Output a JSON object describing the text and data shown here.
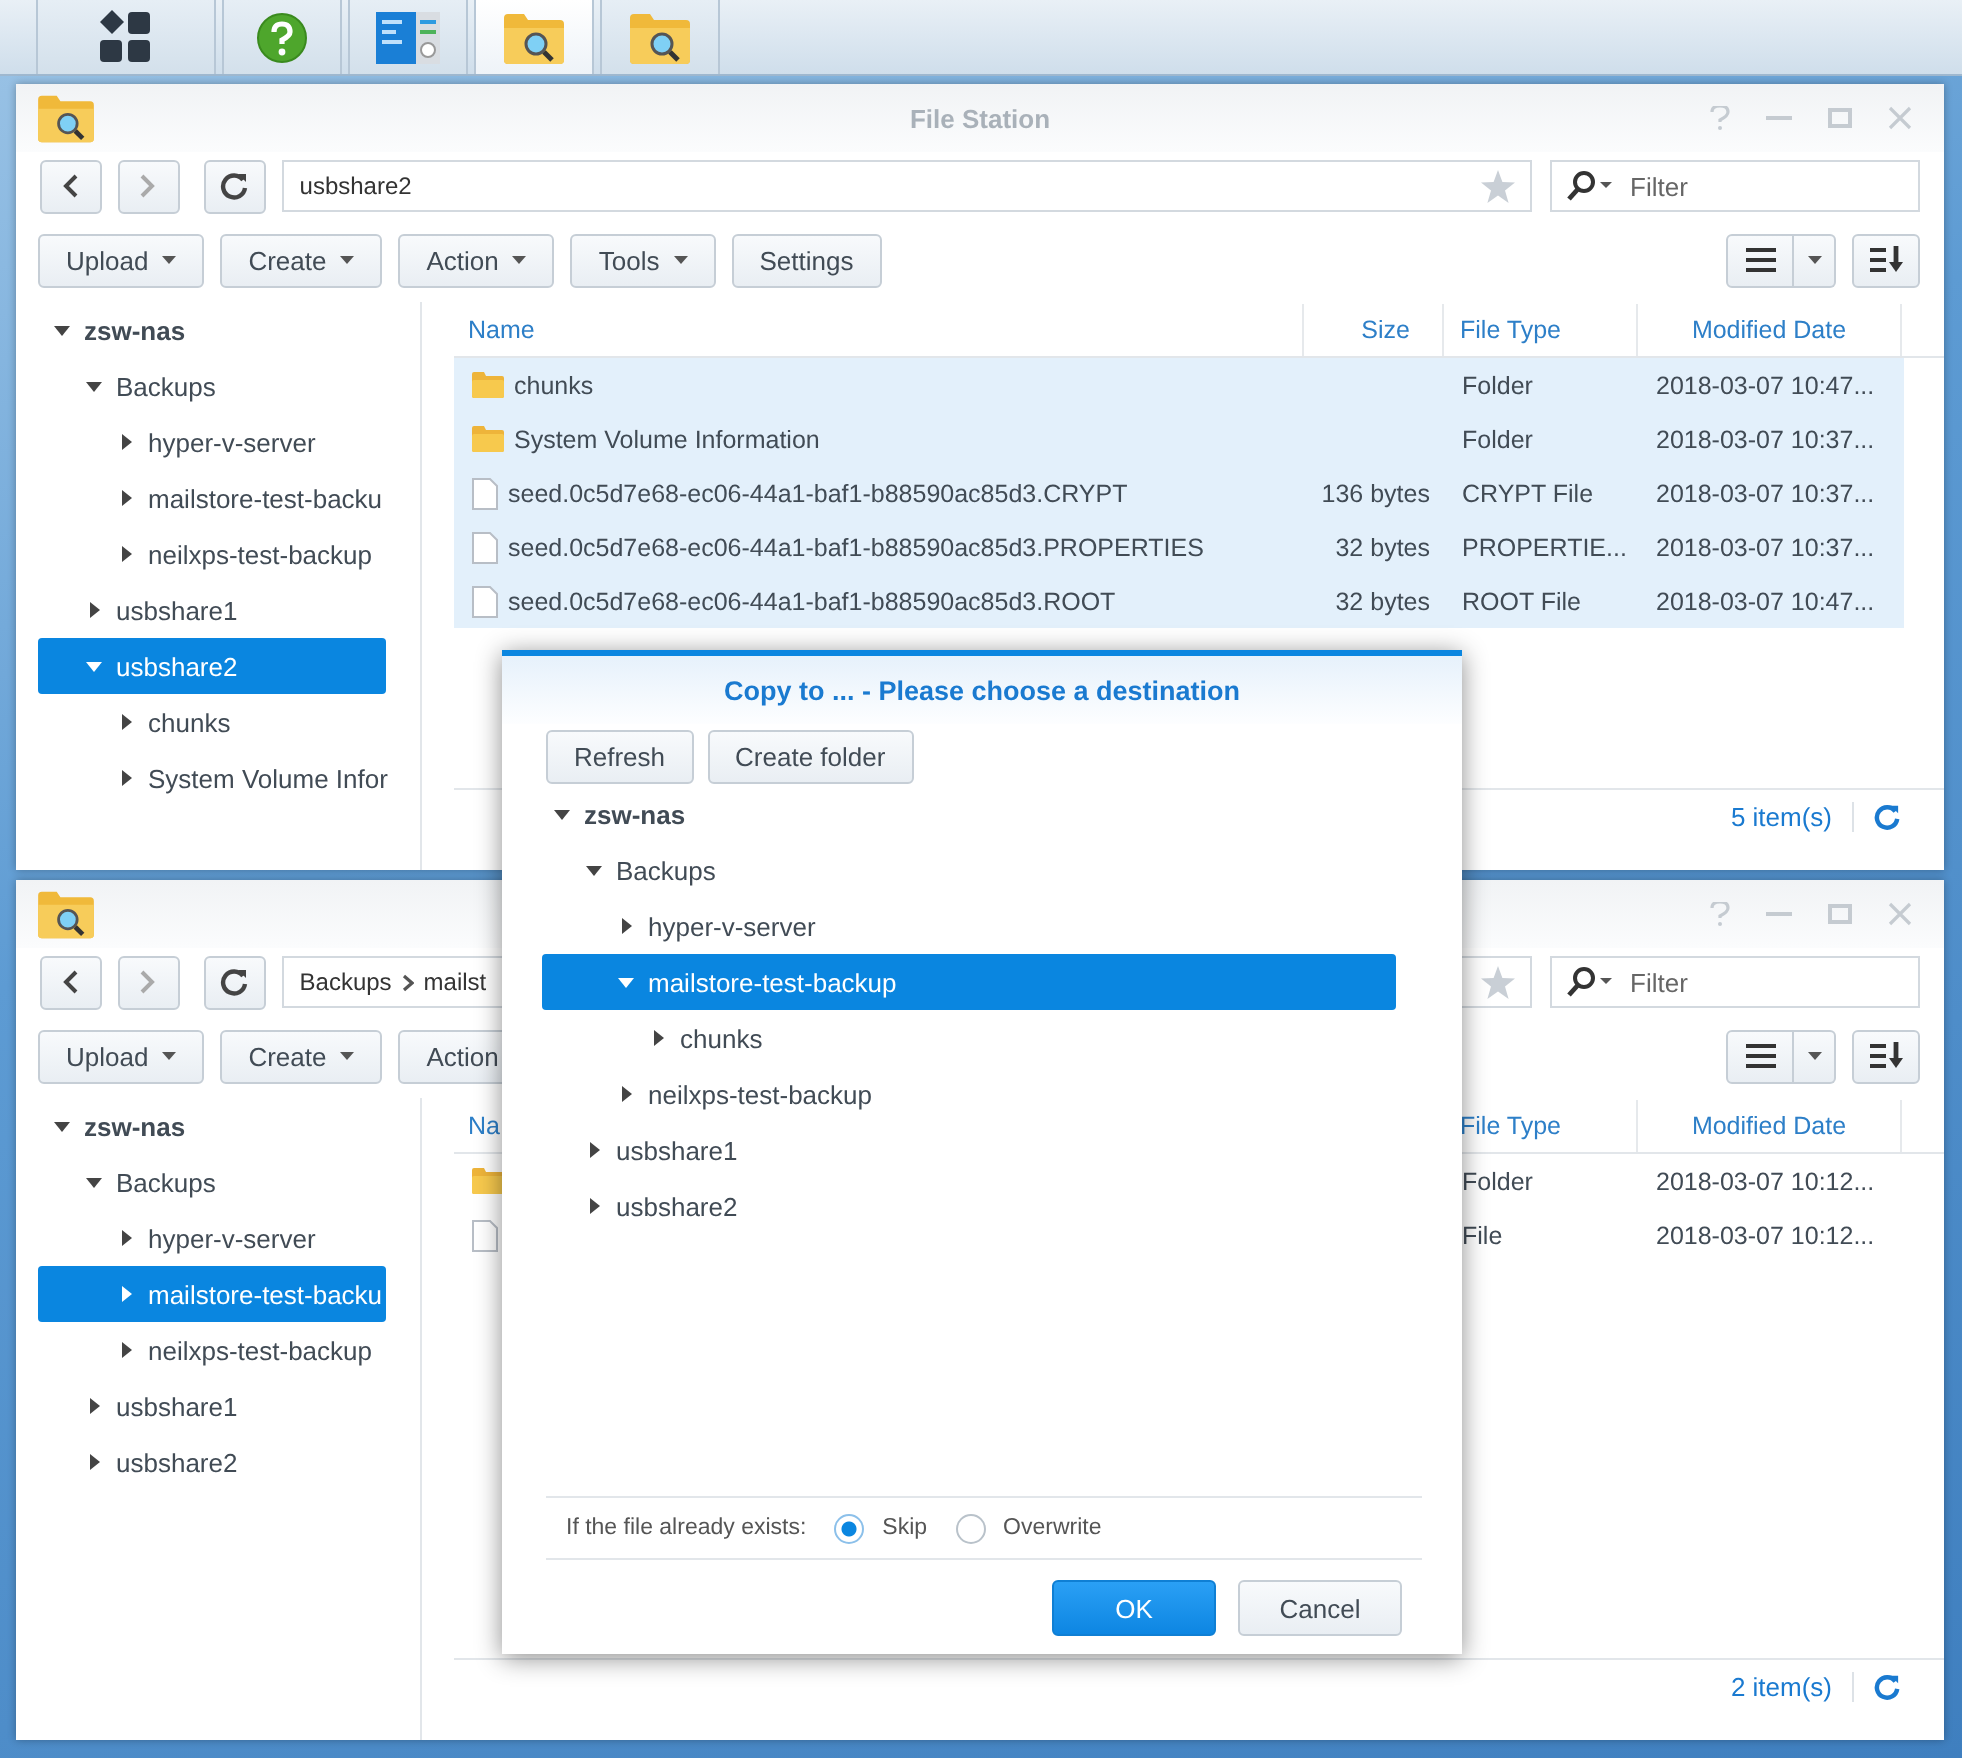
{
  "taskbar": [
    {
      "kind": "main-menu",
      "selected": false
    },
    {
      "kind": "help",
      "selected": false
    },
    {
      "kind": "monitor",
      "selected": false
    },
    {
      "kind": "file-station",
      "selected": true
    },
    {
      "kind": "file-station",
      "selected": false
    }
  ],
  "windows": [
    {
      "title": "File Station",
      "path": [
        "usbshare2"
      ],
      "filter": {
        "placeholder": "Filter"
      },
      "toolbar": [
        {
          "label": "Upload",
          "menu": true
        },
        {
          "label": "Create",
          "menu": true
        },
        {
          "label": "Action",
          "menu": true
        },
        {
          "label": "Tools",
          "menu": true
        },
        {
          "label": "Settings",
          "menu": false
        }
      ],
      "tree": [
        {
          "label": "zsw-nas",
          "expanded": true,
          "selected": false,
          "children": [
            {
              "label": "Backups",
              "expanded": true,
              "selected": false,
              "children": [
                {
                  "label": "hyper-v-server",
                  "expanded": false,
                  "selected": false
                },
                {
                  "label": "mailstore-test-backu",
                  "expanded": false,
                  "selected": false
                },
                {
                  "label": "neilxps-test-backup",
                  "expanded": false,
                  "selected": false
                }
              ]
            },
            {
              "label": "usbshare1",
              "expanded": false,
              "selected": false
            },
            {
              "label": "usbshare2",
              "expanded": true,
              "selected": true,
              "children": [
                {
                  "label": "chunks",
                  "expanded": false,
                  "selected": false
                },
                {
                  "label": "System Volume Infor",
                  "expanded": false,
                  "selected": false
                }
              ]
            }
          ]
        }
      ],
      "columns": [
        {
          "kind": "name",
          "label": "Name"
        },
        {
          "kind": "size",
          "label": "Size"
        },
        {
          "kind": "file_type",
          "label": "File Type"
        },
        {
          "kind": "modified",
          "label": "Modified Date"
        }
      ],
      "rows": [
        {
          "kind": "folder",
          "selected": true,
          "name": "chunks",
          "file_type": "Folder",
          "modified": "2018-03-07 10:47..."
        },
        {
          "kind": "folder",
          "selected": true,
          "name": "System Volume Information",
          "file_type": "Folder",
          "modified": "2018-03-07 10:37..."
        },
        {
          "kind": "file",
          "selected": true,
          "name": "seed.0c5d7e68-ec06-44a1-baf1-b88590ac85d3.CRYPT",
          "size": "136 bytes",
          "file_type": "CRYPT File",
          "modified": "2018-03-07 10:37..."
        },
        {
          "kind": "file",
          "selected": true,
          "name": "seed.0c5d7e68-ec06-44a1-baf1-b88590ac85d3.PROPERTIES",
          "size": "32 bytes",
          "file_type": "PROPERTIE...",
          "modified": "2018-03-07 10:37..."
        },
        {
          "kind": "file",
          "selected": true,
          "name": "seed.0c5d7e68-ec06-44a1-baf1-b88590ac85d3.ROOT",
          "size": "32 bytes",
          "file_type": "ROOT File",
          "modified": "2018-03-07 10:47..."
        }
      ],
      "status": "5 item(s)"
    },
    {
      "path": [
        "Backups",
        "mailst"
      ],
      "filter": {
        "placeholder": "Filter"
      },
      "toolbar": [
        {
          "label": "Upload",
          "menu": true
        },
        {
          "label": "Create",
          "menu": true
        },
        {
          "label": "Action"
        }
      ],
      "tree": [
        {
          "label": "zsw-nas",
          "expanded": true,
          "selected": false,
          "children": [
            {
              "label": "Backups",
              "expanded": true,
              "selected": false,
              "children": [
                {
                  "label": "hyper-v-server",
                  "expanded": false,
                  "selected": false
                },
                {
                  "label": "mailstore-test-backu",
                  "expanded": false,
                  "selected": true
                },
                {
                  "label": "neilxps-test-backup",
                  "expanded": false,
                  "selected": false
                }
              ]
            },
            {
              "label": "usbshare1",
              "expanded": false,
              "selected": false
            },
            {
              "label": "usbshare2",
              "expanded": false,
              "selected": false
            }
          ]
        }
      ],
      "columns": [
        {
          "kind": "name",
          "label": "Na"
        },
        {
          "kind": "file_type",
          "label": "File Type"
        },
        {
          "kind": "modified",
          "label": "Modified Date"
        }
      ],
      "rows": [
        {
          "kind": "folder",
          "selected": false,
          "file_type": "Folder",
          "modified": "2018-03-07 10:12..."
        },
        {
          "kind": "file",
          "selected": false,
          "file_type": "File",
          "modified": "2018-03-07 10:12..."
        }
      ],
      "status": "2 item(s)"
    }
  ],
  "dialog": {
    "title": "Copy to ... - Please choose a destination",
    "buttons": [
      "Refresh",
      "Create folder"
    ],
    "tree": [
      {
        "label": "zsw-nas",
        "expanded": true,
        "selected": false,
        "children": [
          {
            "label": "Backups",
            "expanded": true,
            "selected": false,
            "children": [
              {
                "label": "hyper-v-server",
                "expanded": false,
                "selected": false
              },
              {
                "label": "mailstore-test-backup",
                "expanded": true,
                "selected": true,
                "children": [
                  {
                    "label": "chunks",
                    "expanded": false,
                    "selected": false
                  }
                ]
              },
              {
                "label": "neilxps-test-backup",
                "expanded": false,
                "selected": false
              }
            ]
          },
          {
            "label": "usbshare1",
            "expanded": false,
            "selected": false
          },
          {
            "label": "usbshare2",
            "expanded": false,
            "selected": false
          }
        ]
      }
    ],
    "prompt": "If the file already exists:",
    "options": [
      {
        "label": "Skip",
        "selected": true
      },
      {
        "label": "Overwrite",
        "selected": false
      }
    ],
    "ok": "OK",
    "cancel": "Cancel"
  }
}
